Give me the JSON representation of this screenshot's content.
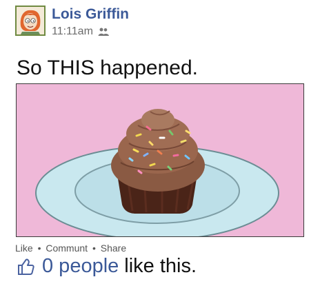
{
  "post": {
    "author_name": "Lois Griffin",
    "timestamp": "11:11am",
    "audience_icon": "friends-icon",
    "status_text": "So THIS happened.",
    "photo": {
      "subject": "cupcake-illustration"
    },
    "actions": {
      "like": "Like",
      "comment": "Communt",
      "share": "Share",
      "separator": "•"
    },
    "likes": {
      "icon": "thumbs-up-icon",
      "count_text": "0 people",
      "suffix_text": "like this."
    }
  },
  "colors": {
    "link_blue": "#3b5998",
    "photo_background": "#efb8d8",
    "plate": "#c9e8ef",
    "frosting": "#8a5a43",
    "cupcake_liner": "#4a2418"
  }
}
